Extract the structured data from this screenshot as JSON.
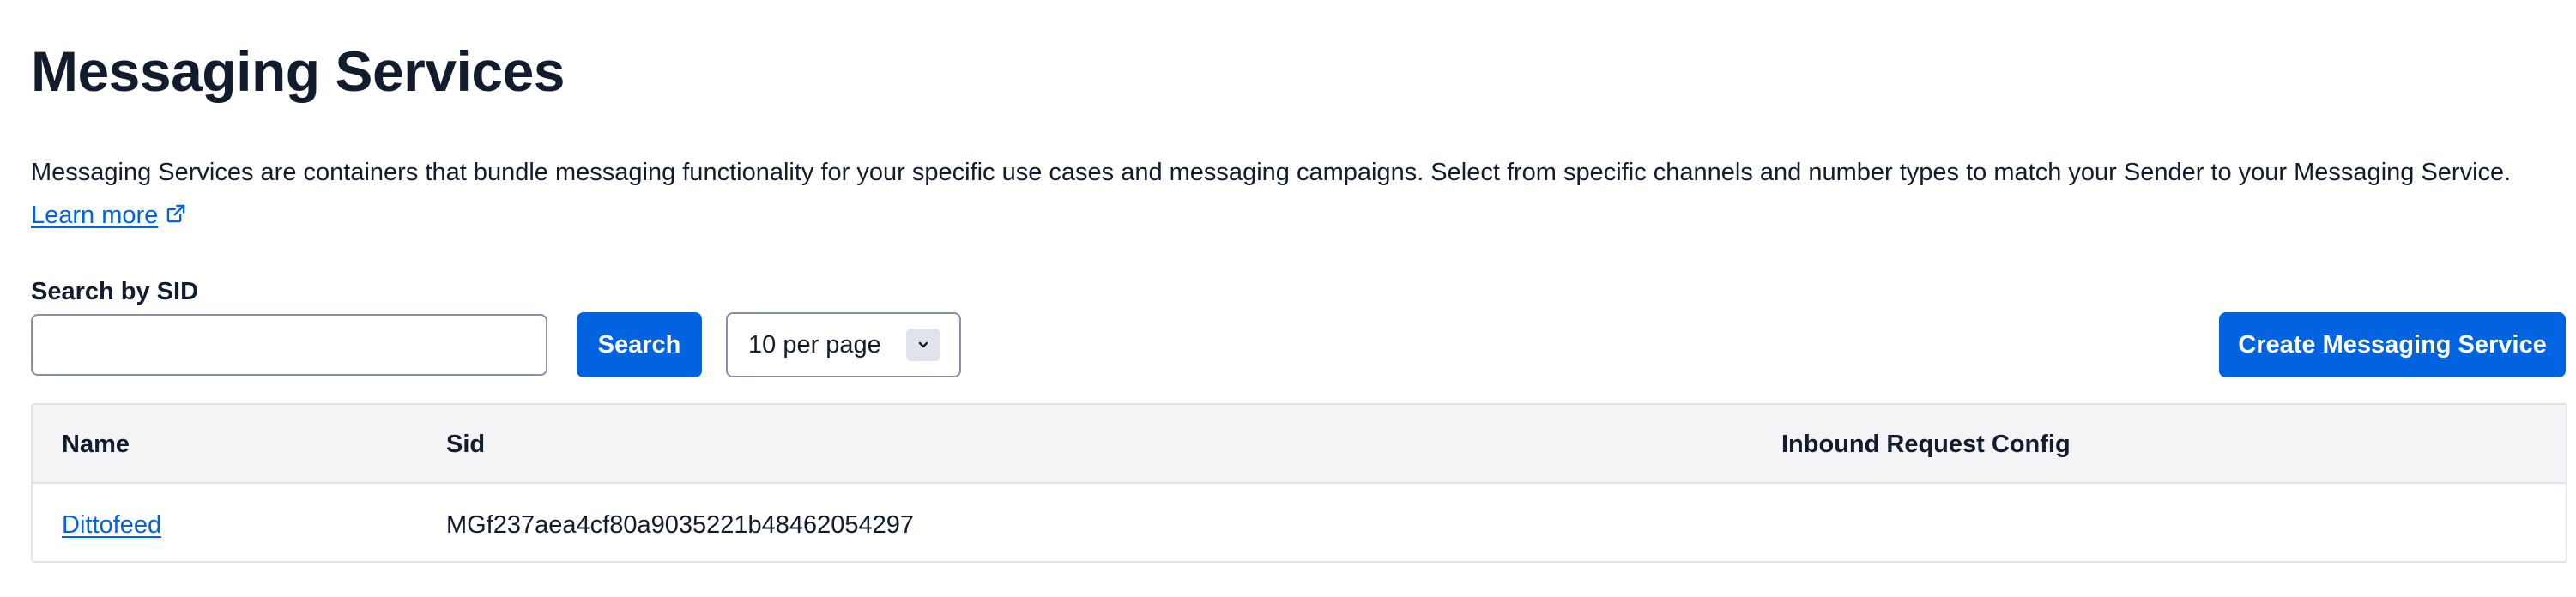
{
  "page": {
    "title": "Messaging Services",
    "description": "Messaging Services are containers that bundle messaging functionality for your specific use cases and messaging campaigns. Select from specific channels and number types to match your Sender to your Messaging Service.",
    "learn_more_label": "Learn more",
    "learn_more_icon": "external-link-icon"
  },
  "search": {
    "label": "Search by SID",
    "value": "",
    "placeholder": "",
    "button_label": "Search"
  },
  "pagination": {
    "per_page_selected": "10 per page",
    "dropdown_icon": "chevron-down-icon"
  },
  "actions": {
    "create_label": "Create Messaging Service"
  },
  "table": {
    "columns": [
      "Name",
      "Sid",
      "Inbound Request Config"
    ],
    "rows": [
      {
        "name": "Dittofeed",
        "sid": "MGf237aea4cf80a9035221b48462054297",
        "inbound_request_config": ""
      }
    ]
  },
  "colors": {
    "primary": "#0263e0",
    "text": "#121c2d",
    "header_bg": "#f4f4f6",
    "border": "#e1e3ea"
  }
}
